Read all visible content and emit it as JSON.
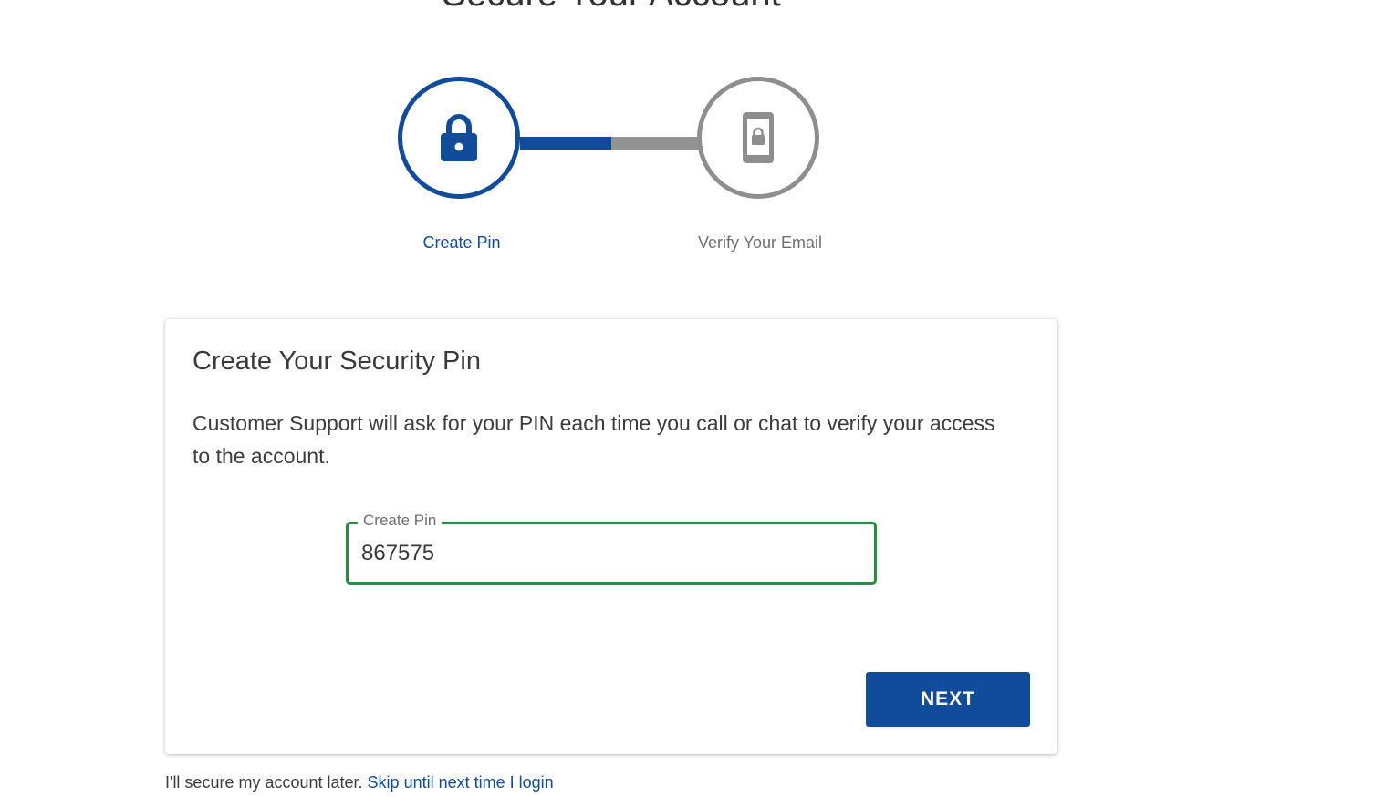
{
  "page": {
    "title": "Secure Your Account"
  },
  "stepper": {
    "steps": [
      {
        "label": "Create Pin",
        "icon": "lock-icon",
        "state": "active"
      },
      {
        "label": "Verify Your Email",
        "icon": "mobile-lock-icon",
        "state": "inactive"
      }
    ],
    "progress_fraction": 0.5
  },
  "card": {
    "title": "Create Your Security Pin",
    "description": "Customer Support will ask for your PIN each time you call or chat to verify your access to the account.",
    "pin_field": {
      "label": "Create Pin",
      "value": "867575"
    },
    "next_label": "NEXT"
  },
  "footer": {
    "note": "I'll secure my account later.",
    "skip_label": "Skip until next time I login"
  },
  "colors": {
    "primary": "#114b9b",
    "inactive": "#8e8e8e",
    "field_border_valid": "#2a8a3e"
  }
}
